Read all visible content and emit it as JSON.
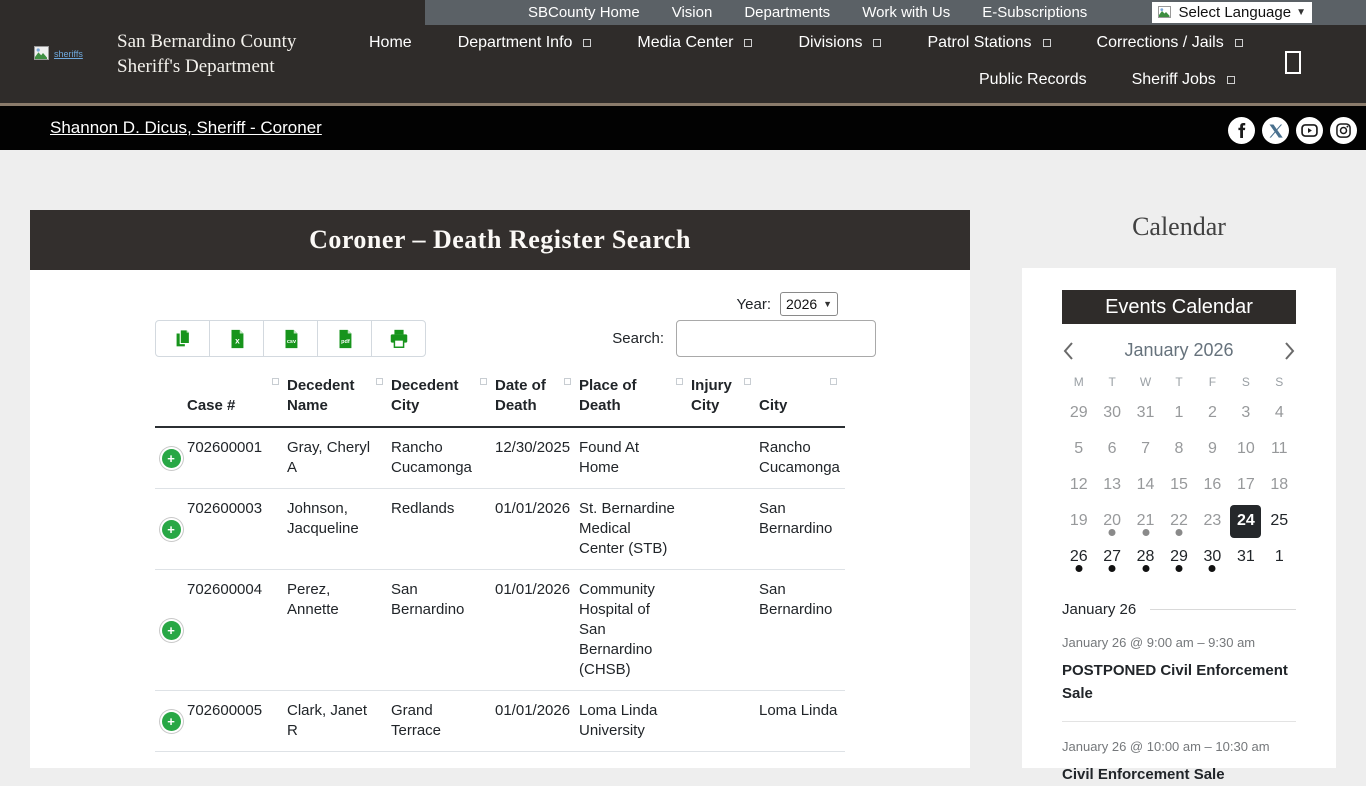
{
  "utility_nav": {
    "items": [
      "SBCounty Home",
      "Vision",
      "Departments",
      "Work with Us",
      "E-Subscriptions"
    ],
    "language_selector_label": "Select Language"
  },
  "header": {
    "site_title_line1": "San Bernardino County",
    "site_title_line2": "Sheriff's Department",
    "logo_alt_text": "sheriffs",
    "nav_row1": [
      {
        "label": "Home",
        "has_dropdown": false
      },
      {
        "label": "Department Info",
        "has_dropdown": true
      },
      {
        "label": "Media Center",
        "has_dropdown": true
      },
      {
        "label": "Divisions",
        "has_dropdown": true
      },
      {
        "label": "Patrol Stations",
        "has_dropdown": true
      },
      {
        "label": "Corrections / Jails",
        "has_dropdown": true
      }
    ],
    "nav_row2": [
      {
        "label": "Public Records",
        "has_dropdown": false
      },
      {
        "label": "Sheriff Jobs",
        "has_dropdown": true
      }
    ]
  },
  "breadcrumb": {
    "link_label": "Shannon D. Dicus, Sheriff - Coroner"
  },
  "social_icons": [
    "facebook-icon",
    "x-twitter-icon",
    "youtube-icon",
    "instagram-icon"
  ],
  "page": {
    "title": "Coroner – Death Register Search",
    "year_label": "Year:",
    "year_value": "2026",
    "search_label": "Search:",
    "search_value": "",
    "export_buttons": [
      "copy",
      "excel",
      "csv",
      "pdf",
      "print"
    ]
  },
  "table": {
    "headers": [
      "Case #",
      "Decedent Name",
      "Decedent City",
      "Date of Death",
      "Place of Death",
      "Injury City",
      "City"
    ],
    "rows": [
      {
        "case_number": "702600001",
        "decedent_name": "Gray, Cheryl A",
        "decedent_city": "Rancho Cucamonga",
        "date_of_death": "12/30/2025",
        "place_of_death": "Found At Home",
        "injury_city": "",
        "city": "Rancho Cucamonga"
      },
      {
        "case_number": "702600003",
        "decedent_name": "Johnson, Jacqueline",
        "decedent_city": "Redlands",
        "date_of_death": "01/01/2026",
        "place_of_death": "St. Bernardine Medical Center (STB)",
        "injury_city": "",
        "city": "San Bernardino"
      },
      {
        "case_number": "702600004",
        "decedent_name": "Perez, Annette",
        "decedent_city": "San Bernardino",
        "date_of_death": "01/01/2026",
        "place_of_death": "Community Hospital of San Bernardino (CHSB)",
        "injury_city": "",
        "city": "San Bernardino"
      },
      {
        "case_number": "702600005",
        "decedent_name": "Clark, Janet R",
        "decedent_city": "Grand Terrace",
        "date_of_death": "01/01/2026",
        "place_of_death": "Loma Linda University",
        "injury_city": "",
        "city": "Loma Linda"
      }
    ]
  },
  "calendar": {
    "heading": "Calendar",
    "card_title": "Events Calendar",
    "month": "January 2026",
    "weekdays": [
      "M",
      "T",
      "W",
      "T",
      "F",
      "S",
      "S"
    ],
    "weeks": [
      [
        {
          "d": "29",
          "s": "muted",
          "dot": ""
        },
        {
          "d": "30",
          "s": "muted",
          "dot": ""
        },
        {
          "d": "31",
          "s": "muted",
          "dot": ""
        },
        {
          "d": "1",
          "s": "muted",
          "dot": ""
        },
        {
          "d": "2",
          "s": "muted",
          "dot": ""
        },
        {
          "d": "3",
          "s": "muted",
          "dot": ""
        },
        {
          "d": "4",
          "s": "muted",
          "dot": ""
        }
      ],
      [
        {
          "d": "5",
          "s": "muted",
          "dot": ""
        },
        {
          "d": "6",
          "s": "muted",
          "dot": ""
        },
        {
          "d": "7",
          "s": "muted",
          "dot": ""
        },
        {
          "d": "8",
          "s": "muted",
          "dot": ""
        },
        {
          "d": "9",
          "s": "muted",
          "dot": ""
        },
        {
          "d": "10",
          "s": "muted",
          "dot": ""
        },
        {
          "d": "11",
          "s": "muted",
          "dot": ""
        }
      ],
      [
        {
          "d": "12",
          "s": "muted",
          "dot": ""
        },
        {
          "d": "13",
          "s": "muted",
          "dot": ""
        },
        {
          "d": "14",
          "s": "muted",
          "dot": ""
        },
        {
          "d": "15",
          "s": "muted",
          "dot": ""
        },
        {
          "d": "16",
          "s": "muted",
          "dot": ""
        },
        {
          "d": "17",
          "s": "muted",
          "dot": ""
        },
        {
          "d": "18",
          "s": "muted",
          "dot": ""
        }
      ],
      [
        {
          "d": "19",
          "s": "muted",
          "dot": ""
        },
        {
          "d": "20",
          "s": "muted",
          "dot": "gray"
        },
        {
          "d": "21",
          "s": "muted",
          "dot": "gray"
        },
        {
          "d": "22",
          "s": "muted",
          "dot": "gray"
        },
        {
          "d": "23",
          "s": "muted",
          "dot": ""
        },
        {
          "d": "24",
          "s": "selected",
          "dot": ""
        },
        {
          "d": "25",
          "s": "dark",
          "dot": ""
        }
      ],
      [
        {
          "d": "26",
          "s": "dark",
          "dot": "black"
        },
        {
          "d": "27",
          "s": "dark",
          "dot": "black"
        },
        {
          "d": "28",
          "s": "dark",
          "dot": "black"
        },
        {
          "d": "29",
          "s": "dark",
          "dot": "black"
        },
        {
          "d": "30",
          "s": "dark",
          "dot": "black"
        },
        {
          "d": "31",
          "s": "dark",
          "dot": ""
        },
        {
          "d": "1",
          "s": "dark",
          "dot": ""
        }
      ]
    ],
    "events_day_header": "January 26",
    "events": [
      {
        "time": "January 26 @ 9:00 am – 9:30 am",
        "title": "POSTPONED Civil Enforcement Sale"
      },
      {
        "time": "January 26 @ 10:00 am – 10:30 am",
        "title": "Civil Enforcement Sale"
      }
    ]
  },
  "colors": {
    "header_bg": "#2f2c2a",
    "utility_bar_bg": "#5b6166",
    "breadcrumb_border": "#8a7b6b",
    "title_bar_bg": "#332f2d",
    "accent_green": "#28a745",
    "export_icon_green": "#17941c",
    "selected_day_bg": "#25282b"
  }
}
